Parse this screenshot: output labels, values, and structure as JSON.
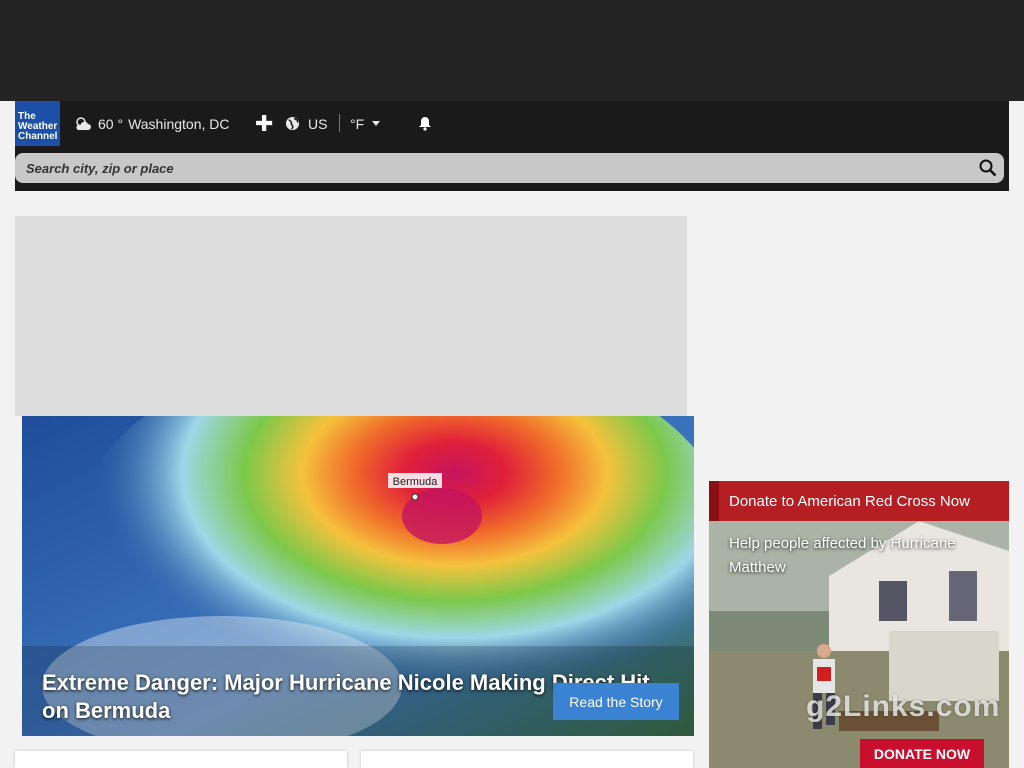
{
  "header": {
    "logo": [
      "The",
      "Weather",
      "Channel"
    ],
    "weather_icon": "partly-cloudy-icon",
    "temperature": "60 °",
    "location": "Washington, DC",
    "add_icon": "plus-icon",
    "edition_icon": "globe-icon",
    "edition": "US",
    "unit": "°F",
    "alerts_icon": "bell-icon",
    "search_placeholder": "Search city, zip or place",
    "search_icon": "search-icon"
  },
  "hero": {
    "map_label": "Bermuda",
    "title": "Extreme Danger: Major Hurricane Nicole Making Direct Hit on Bermuda",
    "cta": "Read the Story"
  },
  "donate": {
    "heading": "Donate to American Red Cross Now",
    "text": "Help people affected by Hurricane Matthew",
    "button": "DONATE NOW"
  },
  "watermark": "g2Links.com",
  "colors": {
    "header_bg": "#1a1a1a",
    "logo_bg": "#1b4fa8",
    "cta_blue": "#3a83d2",
    "redcross_red": "#b51f24"
  }
}
